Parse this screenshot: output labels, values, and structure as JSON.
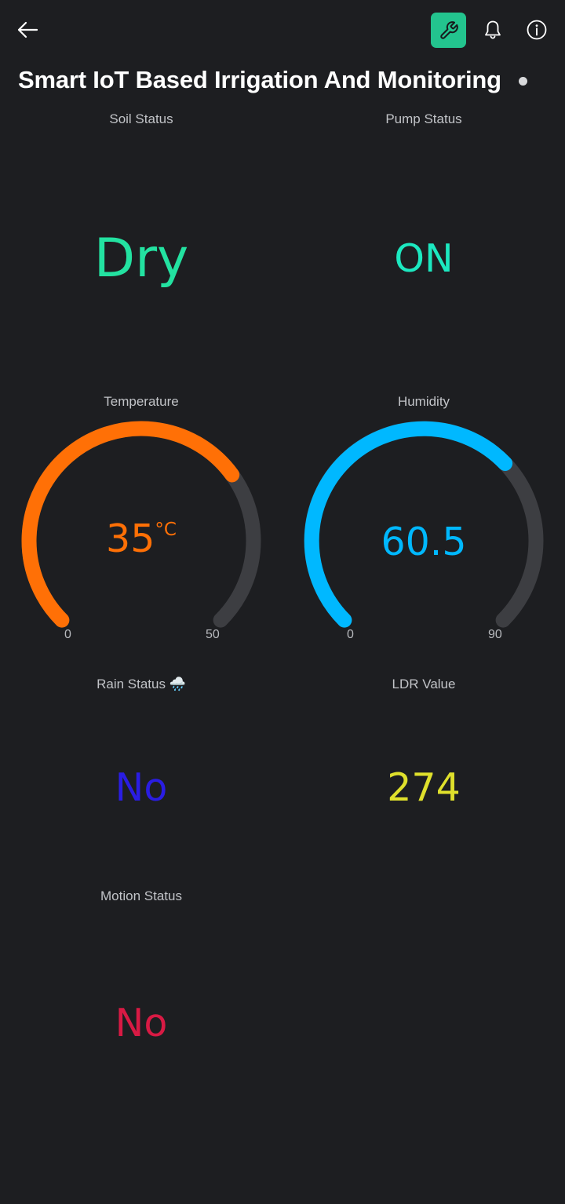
{
  "header": {
    "title": "Smart IoT Based Irrigation And Monitoring",
    "icons": [
      "back-arrow-icon",
      "wrench-icon",
      "bell-icon",
      "info-icon"
    ],
    "accent_color": "#23c48e"
  },
  "widgets": {
    "soil": {
      "label": "Soil Status",
      "value": "Dry",
      "color": "#23e2a1"
    },
    "pump": {
      "label": "Pump Status",
      "value": "ON",
      "color": "#1ce8c0"
    },
    "temperature": {
      "label": "Temperature",
      "value": "35",
      "unit": "°C",
      "min": "0",
      "max": "50",
      "fraction": 0.7,
      "color": "#ff7006"
    },
    "humidity": {
      "label": "Humidity",
      "value": "60.5",
      "min": "0",
      "max": "90",
      "fraction": 0.672,
      "color": "#00b8ff"
    },
    "rain": {
      "label": "Rain Status 🌧️",
      "value": "No",
      "color": "#2a1de3"
    },
    "ldr": {
      "label": "LDR Value",
      "value": "274",
      "color": "#dfe02c"
    },
    "motion": {
      "label": "Motion Status",
      "value": "No",
      "color": "#d81a44"
    }
  }
}
